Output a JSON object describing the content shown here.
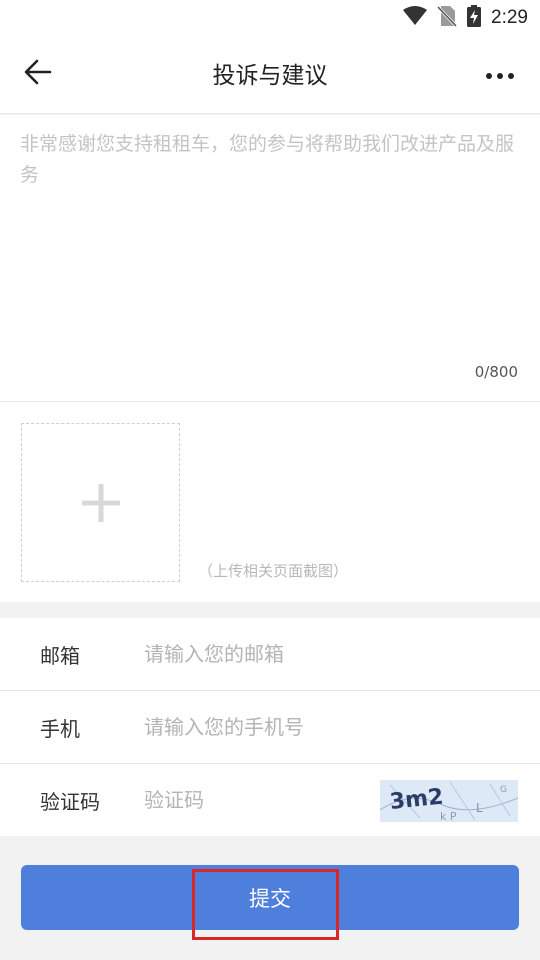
{
  "status_bar": {
    "time": "2:29",
    "icons": [
      "wifi-icon",
      "no-sim-icon",
      "battery-charging-icon"
    ]
  },
  "header": {
    "title": "投诉与建议",
    "back_icon": "arrow-left-icon",
    "more_icon": "more-dots-icon"
  },
  "feedback": {
    "placeholder": "非常感谢您支持租租车，您的参与将帮助我们改进产品及服务",
    "value": "",
    "char_count": "0/800"
  },
  "upload": {
    "add_icon": "plus-icon",
    "hint": "（上传相关页面截图）"
  },
  "form": {
    "email": {
      "label": "邮箱",
      "placeholder": "请输入您的邮箱",
      "value": ""
    },
    "phone": {
      "label": "手机",
      "placeholder": "请输入您的手机号",
      "value": ""
    },
    "captcha": {
      "label": "验证码",
      "placeholder": "验证码",
      "value": "",
      "image_text": "3m2"
    }
  },
  "submit": {
    "label": "提交"
  },
  "colors": {
    "primary": "#4f7fdc",
    "highlight": "#d9262a",
    "background": "#f2f2f2"
  }
}
